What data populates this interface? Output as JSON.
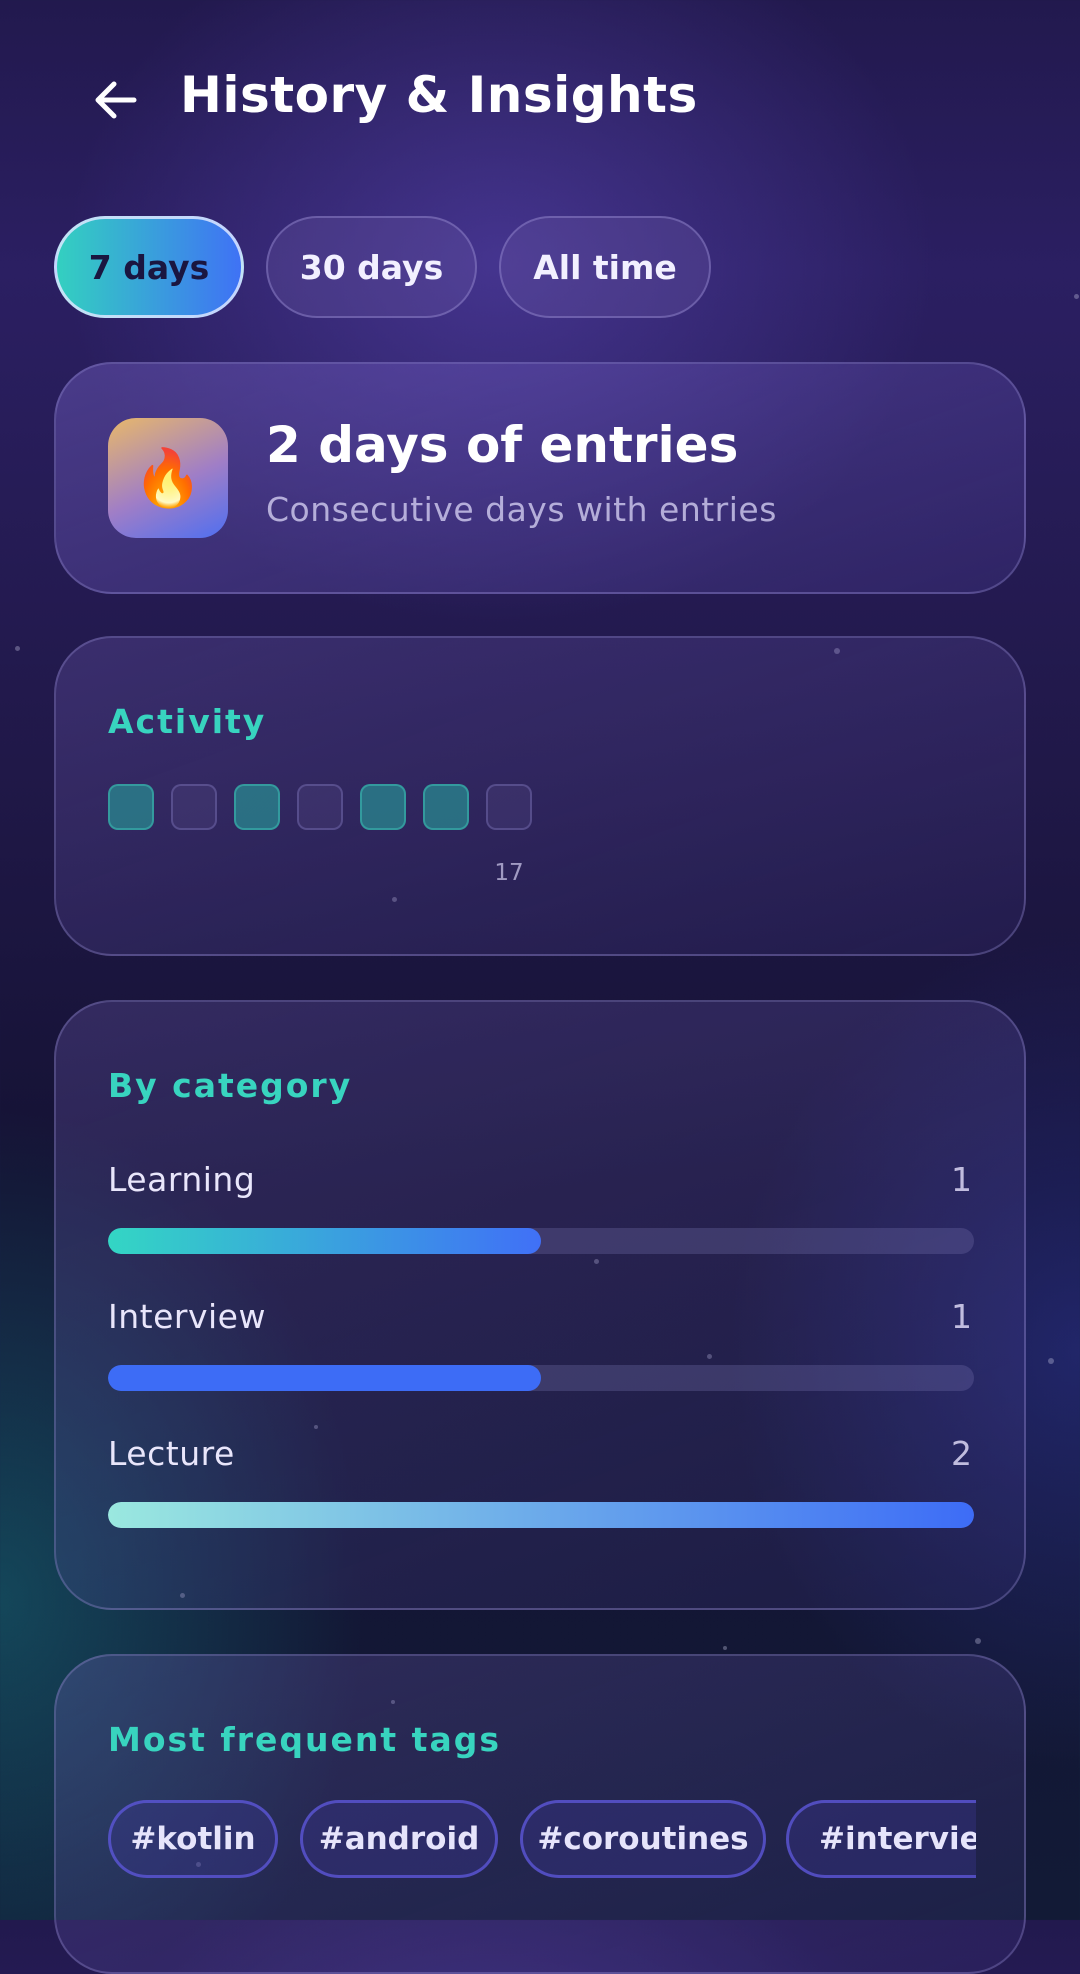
{
  "header": {
    "title": "History & Insights",
    "back_icon": "arrow-left-icon"
  },
  "range_chips": [
    {
      "label": "7 days",
      "selected": true
    },
    {
      "label": "30 days",
      "selected": false
    },
    {
      "label": "All time",
      "selected": false
    }
  ],
  "streak": {
    "icon": "flame-icon",
    "glyph": "🔥",
    "title": "2 days of entries",
    "subtitle": "Consecutive days with entries"
  },
  "activity": {
    "heading": "Activity",
    "days": [
      {
        "active": true,
        "label": ""
      },
      {
        "active": false,
        "label": ""
      },
      {
        "active": true,
        "label": ""
      },
      {
        "active": false,
        "label": ""
      },
      {
        "active": true,
        "label": ""
      },
      {
        "active": true,
        "label": ""
      },
      {
        "active": false,
        "label": "17"
      }
    ]
  },
  "categories": {
    "heading": "By category",
    "items": [
      {
        "name": "Learning",
        "count": "1",
        "fraction": 0.5,
        "gradient": [
          "#33d6c4",
          "#4070f7"
        ]
      },
      {
        "name": "Interview",
        "count": "1",
        "fraction": 0.5,
        "gradient": [
          "#3d6cf6",
          "#3d6cf6"
        ]
      },
      {
        "name": "Lecture",
        "count": "2",
        "fraction": 1.0,
        "gradient": [
          "#9ae8df",
          "#3d6cf6"
        ]
      }
    ]
  },
  "tags": {
    "heading": "Most frequent tags",
    "items": [
      "#kotlin",
      "#android",
      "#coroutines",
      "#interview"
    ]
  },
  "colors": {
    "accent_teal": "#38d4bf",
    "accent_blue": "#3f72f5",
    "background_top": "#2b1f62",
    "background_bottom": "#121a36"
  }
}
